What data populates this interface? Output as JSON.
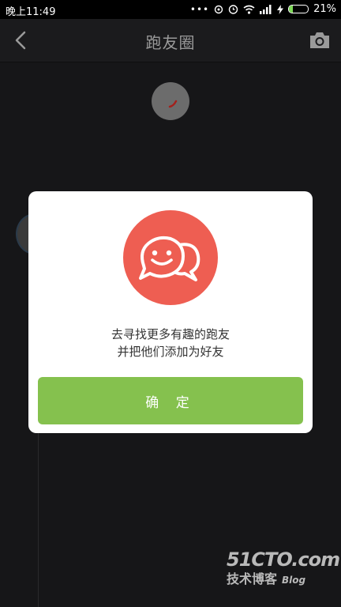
{
  "status_bar": {
    "time": "晚上11:49",
    "battery_percent_text": "21%",
    "battery_level": 0.21
  },
  "header": {
    "title": "跑友圈",
    "back_icon": "chevron-left-icon",
    "camera_icon": "camera-icon"
  },
  "dialog": {
    "icon": "chat-smiley-icon",
    "message_line1": "去寻找更多有趣的跑友",
    "message_line2": "并把他们添加为好友",
    "confirm_label": "确 定"
  },
  "watermark": {
    "main": "51CTO.com",
    "sub": "技术博客",
    "blog": "Blog"
  },
  "colors": {
    "accent_button": "#85c14e",
    "icon_circle": "#ee5e52",
    "battery_fill": "#7ed957"
  }
}
